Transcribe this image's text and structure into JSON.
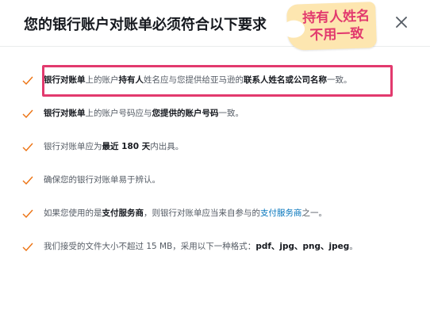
{
  "dialog": {
    "title": "您的银行账户对账单必须符合以下要求",
    "close_icon": "close-icon"
  },
  "sticker": {
    "line1": "持有人姓名",
    "line2": "不用一致",
    "color": "#e23a6e"
  },
  "requirements": [
    {
      "p1": "银行对账单",
      "p2": "上的账户",
      "p3": "持有人",
      "p4": "姓名应与您提供给亚马逊的",
      "p5": "联系人姓名或公司名称",
      "p6": "一致。"
    },
    {
      "p1": "银行对账单",
      "p2": "上的账户号码应与",
      "p3": "您提供的账户号码",
      "p4": "一致。"
    },
    {
      "p1": "银行对账单应为",
      "p2": "最近 180 天",
      "p3": "内出具。"
    },
    {
      "p1": "确保您的银行对账单易于辨认。"
    },
    {
      "p1": "如果您使用的是",
      "p2": "支付服务商",
      "p3": "，则银行对账单应当来自参与的",
      "p4": "支付服务商",
      "p5": "之一。"
    },
    {
      "p1": "我们接受的文件大小不超过 15 MB，采用以下一种格式：",
      "p2": "pdf、jpg、png、jpeg",
      "p3": "。"
    }
  ],
  "colors": {
    "check": "#ec7211",
    "link": "#0073bb",
    "highlight": "#e23a6e"
  }
}
